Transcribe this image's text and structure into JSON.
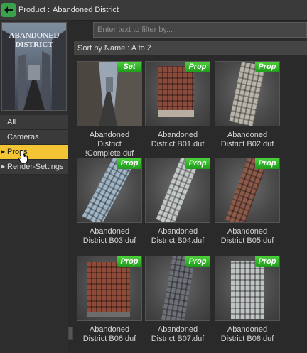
{
  "header": {
    "back_icon": "back-arrow-icon",
    "label": "Product :",
    "product_name": "Abandoned District"
  },
  "promo": {
    "title_line1": "ABANDONED",
    "title_line2": "DISTRICT"
  },
  "categories": [
    {
      "label": "All"
    },
    {
      "label": "Cameras"
    },
    {
      "label": "Props"
    },
    {
      "label": "Render-Settings"
    }
  ],
  "filter": {
    "placeholder": "Enter text to filter by..."
  },
  "sort": {
    "label": "Sort by Name : A to Z"
  },
  "items": [
    {
      "badge": "Set",
      "line1": "Abandoned",
      "line2": "District",
      "line3": "!Complete.duf"
    },
    {
      "badge": "Prop",
      "line1": "Abandoned",
      "line2": "District B01.duf"
    },
    {
      "badge": "Prop",
      "line1": "Abandoned",
      "line2": "District B02.duf"
    },
    {
      "badge": "Prop",
      "line1": "Abandoned",
      "line2": "District B03.duf"
    },
    {
      "badge": "Prop",
      "line1": "Abandoned",
      "line2": "District B04.duf"
    },
    {
      "badge": "Prop",
      "line1": "Abandoned",
      "line2": "District B05.duf"
    },
    {
      "badge": "Prop",
      "line1": "Abandoned",
      "line2": "District B06.duf"
    },
    {
      "badge": "Prop",
      "line1": "Abandoned",
      "line2": "District B07.duf"
    },
    {
      "badge": "Prop",
      "line1": "Abandoned",
      "line2": "District B08.duf"
    }
  ],
  "colors": {
    "accent_selected": "#f3c534",
    "badge_green": "#2fb52a",
    "back_button": "#3aa24a"
  }
}
